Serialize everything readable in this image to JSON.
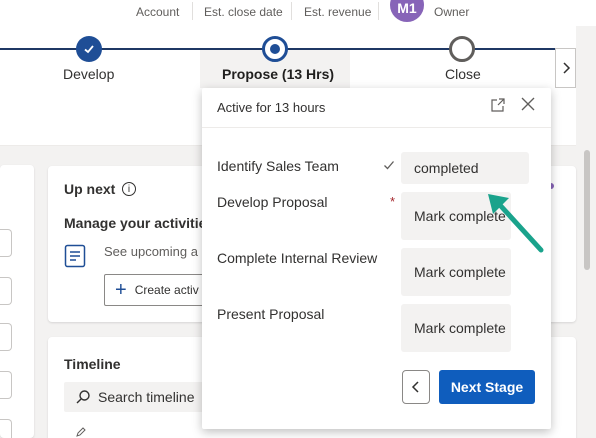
{
  "header": {
    "fields": [
      "Account",
      "Est. close date",
      "Est. revenue"
    ],
    "owner_initials": "M1",
    "owner_name": "",
    "owner_label": "Owner",
    "avatar_color": "#8764b8"
  },
  "stages": [
    {
      "label": "Develop",
      "status": "done"
    },
    {
      "label": "Propose  (13 Hrs)",
      "status": "active"
    },
    {
      "label": "Close",
      "status": "upcoming"
    }
  ],
  "upnext": {
    "title": "Up next",
    "manage_text": "Manage your activities",
    "see_upcoming": "See upcoming a",
    "create_label": "Create activ"
  },
  "timeline": {
    "title": "Timeline",
    "search_placeholder": "Search timeline"
  },
  "flyout": {
    "title": "Active for 13 hours",
    "steps": [
      {
        "label": "Identify Sales Team",
        "button": "completed",
        "done": true,
        "required": false
      },
      {
        "label": "Develop Proposal",
        "button": "Mark complete",
        "done": false,
        "required": true
      },
      {
        "label": "Complete Internal Review",
        "button": "Mark complete",
        "done": false,
        "required": false
      },
      {
        "label": "Present Proposal",
        "button": "Mark complete",
        "done": false,
        "required": false
      }
    ],
    "required_marker": "*",
    "next_stage_label": "Next Stage"
  },
  "colors": {
    "accent": "#0f5dbd",
    "stage_line": "#1f3864",
    "annotation_arrow": "#1aa38c"
  }
}
